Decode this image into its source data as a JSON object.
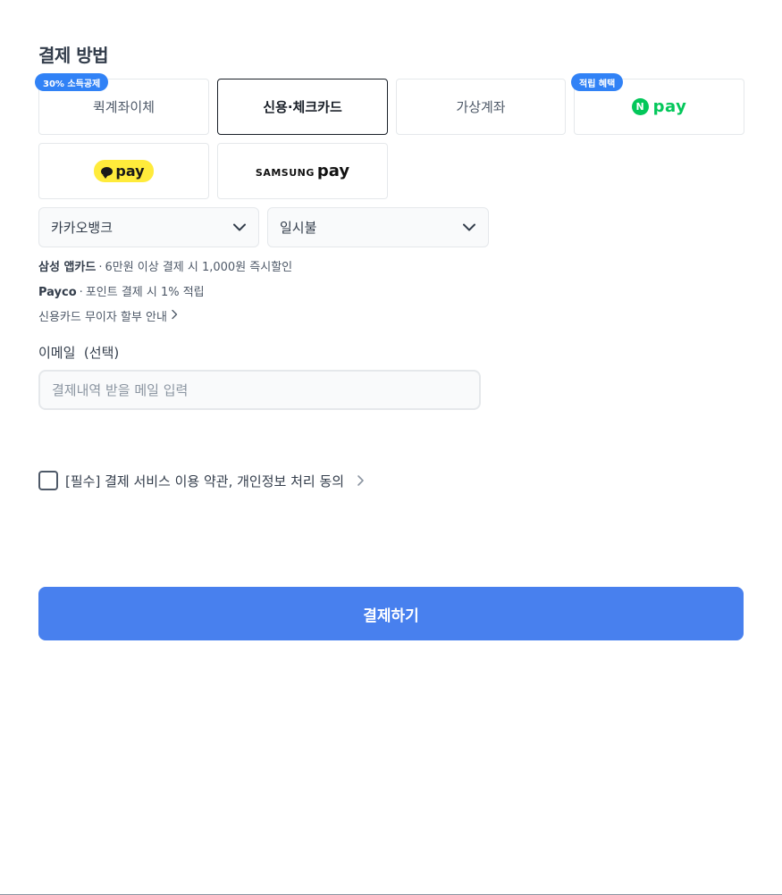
{
  "section_title": "결제 방법",
  "methods": {
    "quick_transfer": {
      "label": "퀵계좌이체",
      "badge": "30% 소득공제"
    },
    "card": {
      "label": "신용·체크카드"
    },
    "virtual_account": {
      "label": "가상계좌"
    },
    "npay": {
      "logo_letter": "N",
      "logo_text": "pay",
      "badge": "적립 혜택"
    },
    "kakaopay": {
      "logo_text": "pay"
    },
    "samsungpay": {
      "brand": "SAMSUNG",
      "pay": "pay"
    }
  },
  "selects": {
    "bank": {
      "value": "카카오뱅크"
    },
    "installment": {
      "value": "일시불"
    }
  },
  "promos": [
    {
      "brand": "삼성 앱카드",
      "separator": "·",
      "text": "6만원 이상 결제 시 1,000원 즉시할인"
    },
    {
      "brand": "Payco",
      "separator": "·",
      "text": "포인트 결제 시 1% 적립"
    }
  ],
  "installment_link": "신용카드 무이자 할부 안내",
  "email": {
    "label": "이메일  (선택)",
    "placeholder": "결제내역 받을 메일 입력",
    "value": ""
  },
  "agreement": {
    "text": "[필수] 결제 서비스 이용 약관, 개인정보 처리 동의",
    "checked": false
  },
  "pay_button": "결제하기",
  "colors": {
    "accent": "#4880ee",
    "badge": "#3182f6",
    "npay_green": "#03c75a",
    "kakao_yellow": "#ffeb3b"
  },
  "icons": [
    "chevron-down-icon",
    "chevron-right-icon",
    "checkbox-icon",
    "npay-logo",
    "kakaopay-logo",
    "samsungpay-logo"
  ]
}
